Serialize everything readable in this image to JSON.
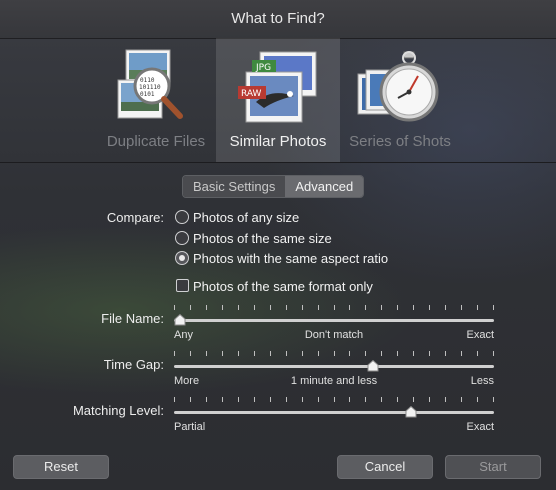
{
  "dialog": {
    "title": "What to Find?"
  },
  "modes": [
    {
      "label": "Duplicate Files",
      "selected": false,
      "icon": "duplicate-files-icon"
    },
    {
      "label": "Similar Photos",
      "selected": true,
      "icon": "similar-photos-icon",
      "badges": [
        "JPG",
        "RAW"
      ]
    },
    {
      "label": "Series of Shots",
      "selected": false,
      "icon": "stopwatch-icon"
    }
  ],
  "settings_tabs": [
    {
      "label": "Basic Settings",
      "active": false
    },
    {
      "label": "Advanced",
      "active": true
    }
  ],
  "compare": {
    "label": "Compare:",
    "options": [
      {
        "label": "Photos of any size",
        "checked": false
      },
      {
        "label": "Photos of the same size",
        "checked": false
      },
      {
        "label": "Photos with the same aspect ratio",
        "checked": true
      }
    ],
    "same_format": {
      "label": "Photos of the same format only",
      "checked": false
    }
  },
  "sliders": {
    "file_name": {
      "label": "File Name:",
      "min_label": "Any",
      "mid_label": "Don't match",
      "max_label": "Exact",
      "value": 0.0
    },
    "time_gap": {
      "label": "Time Gap:",
      "min_label": "More",
      "mid_label": "1 minute and less",
      "max_label": "Less",
      "value": 0.625
    },
    "matching_level": {
      "label": "Matching Level:",
      "min_label": "Partial",
      "max_label": "Exact",
      "value": 0.75
    }
  },
  "footer": {
    "reset_label": "Reset",
    "cancel_label": "Cancel",
    "start_label": "Start",
    "start_enabled": false
  }
}
